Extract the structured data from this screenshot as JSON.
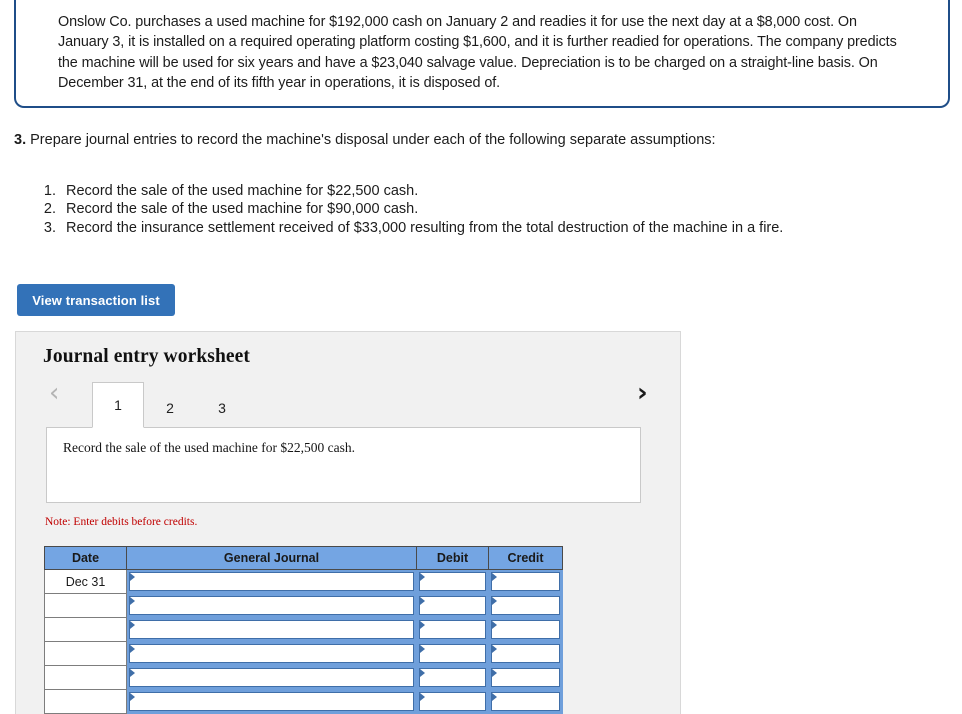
{
  "problem": {
    "text": "Onslow Co. purchases a used machine for $192,000 cash on January 2 and readies it for use the next day at a $8,000 cost. On January 3, it is installed on a required operating platform costing $1,600, and it is further readied for operations. The company predicts the machine will be used for six years and have a $23,040 salvage value. Depreciation is to be charged on a straight-line basis. On December 31, at the end of its fifth year in operations, it is disposed of.",
    "border_color": "#1f4e88"
  },
  "question": {
    "number": "3.",
    "text": "Prepare journal entries to record the machine's disposal under each of the following separate assumptions:",
    "requirements": [
      "Record the sale of the used machine for $22,500 cash.",
      "Record the sale of the used machine for $90,000 cash.",
      "Record the insurance settlement received of $33,000 resulting from the total destruction of the machine in a fire."
    ]
  },
  "toolbar": {
    "view_transaction_list_label": "View transaction list",
    "button_color": "#3372b8"
  },
  "worksheet": {
    "title": "Journal entry worksheet",
    "nav": {
      "prev_icon": "chevron-left-icon",
      "next_icon": "chevron-right-icon",
      "prev_glyph": "‹",
      "next_glyph": "›"
    },
    "tabs": [
      {
        "label": "1",
        "active": true
      },
      {
        "label": "2",
        "active": false
      },
      {
        "label": "3",
        "active": false
      }
    ],
    "prompt": "Record the sale of the used machine for $22,500 cash.",
    "note": "Note: Enter debits before credits.",
    "note_color": "#c00000",
    "table": {
      "header_color": "#74a5e3",
      "columns": [
        "Date",
        "General Journal",
        "Debit",
        "Credit"
      ],
      "rows": [
        {
          "date": "Dec 31",
          "general_journal": "",
          "debit": "",
          "credit": ""
        },
        {
          "date": "",
          "general_journal": "",
          "debit": "",
          "credit": ""
        },
        {
          "date": "",
          "general_journal": "",
          "debit": "",
          "credit": ""
        },
        {
          "date": "",
          "general_journal": "",
          "debit": "",
          "credit": ""
        },
        {
          "date": "",
          "general_journal": "",
          "debit": "",
          "credit": ""
        },
        {
          "date": "",
          "general_journal": "",
          "debit": "",
          "credit": ""
        }
      ]
    }
  }
}
